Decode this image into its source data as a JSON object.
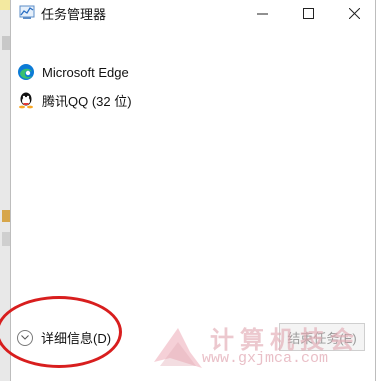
{
  "window": {
    "title": "任务管理器",
    "controls": {
      "minimize": "—",
      "maximize": "☐",
      "close": "✕"
    }
  },
  "apps": [
    {
      "name": "Microsoft Edge",
      "icon": "edge-icon"
    },
    {
      "name": "腾讯QQ (32 位)",
      "icon": "qq-icon"
    }
  ],
  "footer": {
    "details_label": "详细信息(D)",
    "end_task_label": "结束任务(E)"
  },
  "watermark": {
    "text": "计算机技会",
    "url": "www.gxjmca.com"
  },
  "colors": {
    "highlight_ellipse": "#d81e1e",
    "watermark": "#e2aab4",
    "edge_blue": "#0c7bd6",
    "edge_green": "#3ac06f"
  }
}
